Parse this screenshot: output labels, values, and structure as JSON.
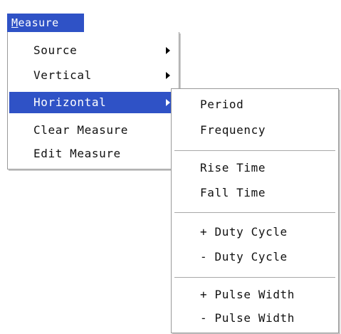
{
  "menubar": {
    "title_mnemonic": "M",
    "title_rest": "easure"
  },
  "main_menu": {
    "items": [
      {
        "label": "Source"
      },
      {
        "label": "Vertical"
      },
      {
        "label": "Horizontal"
      },
      {
        "label": "Clear Measure"
      },
      {
        "label": "Edit Measure"
      }
    ]
  },
  "sub_menu": {
    "items": [
      {
        "label": "Period"
      },
      {
        "label": "Frequency"
      },
      {
        "label": "Rise Time"
      },
      {
        "label": "Fall Time"
      },
      {
        "label": "+ Duty Cycle"
      },
      {
        "label": "- Duty Cycle"
      },
      {
        "label": "+ Pulse Width"
      },
      {
        "label": "- Pulse Width"
      }
    ]
  },
  "colors": {
    "highlight": "#2f52c6",
    "menu_background": "#ffffff",
    "border": "#9a9a9a"
  }
}
